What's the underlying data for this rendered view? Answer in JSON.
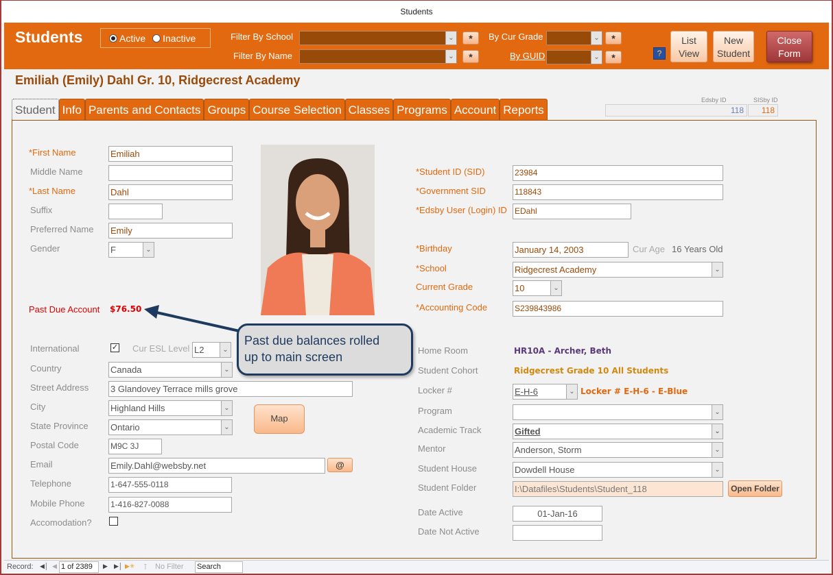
{
  "window": {
    "title": "Students"
  },
  "header": {
    "app_title": "Students",
    "status_filter": {
      "options": [
        "Active",
        "Inactive"
      ],
      "selected": "Active"
    },
    "filter_school_label": "Filter By School",
    "filter_name_label": "Filter By Name",
    "cur_grade_label": "By Cur Grade",
    "guid_label": "By GUID",
    "filter_school_value": "",
    "filter_name_value": "",
    "cur_grade_value": "",
    "guid_value": "",
    "clear_label": "*",
    "help_label": "?",
    "list_view_label": [
      "List",
      "View"
    ],
    "new_student_label": [
      "New",
      "Student"
    ],
    "close_form_label": [
      "Close",
      "Form"
    ]
  },
  "student_heading": "Emiliah (Emily)  Dahl  Gr. 10, Ridgecrest Academy",
  "tabs": [
    {
      "label": "Student",
      "active": true
    },
    {
      "label": "Info"
    },
    {
      "label": "Parents and Contacts"
    },
    {
      "label": "Groups"
    },
    {
      "label": "Course Selection"
    },
    {
      "label": "Classes"
    },
    {
      "label": "Programs"
    },
    {
      "label": "Account"
    },
    {
      "label": "Reports"
    }
  ],
  "ids": {
    "edsby_label": "Edsby ID",
    "edsby_value": "118",
    "sisby_label": "SISby ID",
    "sisby_value": "118"
  },
  "left": {
    "first_name": {
      "label": "*First Name",
      "value": "Emiliah"
    },
    "middle_name": {
      "label": "Middle Name",
      "value": ""
    },
    "last_name": {
      "label": "*Last Name",
      "value": "Dahl"
    },
    "suffix": {
      "label": "Suffix",
      "value": ""
    },
    "preferred_name": {
      "label": "Preferred Name",
      "value": "Emily"
    },
    "gender": {
      "label": "Gender",
      "value": "F"
    },
    "past_due": {
      "label": "Past Due Account",
      "value": "$76.50"
    },
    "international": {
      "label": "International",
      "checked": true
    },
    "esl_level": {
      "label": "Cur ESL Level",
      "value": "L2"
    },
    "country": {
      "label": "Country",
      "value": "Canada"
    },
    "street": {
      "label": "Street Address",
      "value": "3 Glandovey Terrace mills grove"
    },
    "city": {
      "label": "City",
      "value": "Highland Hills"
    },
    "state": {
      "label": "State Province",
      "value": "Ontario"
    },
    "postal": {
      "label": "Postal Code",
      "value": "M9C 3J"
    },
    "email": {
      "label": "Email",
      "value": "Emily.Dahl@websby.net",
      "button": "@"
    },
    "telephone": {
      "label": "Telephone",
      "value": "1-647-555-0118"
    },
    "mobile": {
      "label": "Mobile Phone",
      "value": "1-416-827-0088"
    },
    "accommodation": {
      "label": "Accomodation?",
      "checked": false
    },
    "map_button": "Map"
  },
  "right": {
    "student_id": {
      "label": "*Student ID (SID)",
      "value": "23984"
    },
    "gov_sid": {
      "label": "*Government SID",
      "value": "118843"
    },
    "edsby_login": {
      "label": "*Edsby User (Login) ID",
      "value": "EDahl"
    },
    "birthday": {
      "label": "*Birthday",
      "value": "January 14, 2003"
    },
    "cur_age": {
      "label": "Cur Age",
      "value": "16 Years Old"
    },
    "school": {
      "label": "*School",
      "value": "Ridgecrest Academy"
    },
    "grade": {
      "label": "Current Grade",
      "value": "10"
    },
    "accounting": {
      "label": "*Accounting Code",
      "value": "S239843986"
    },
    "home_room": {
      "label": "Home Room",
      "value": "HR10A - Archer, Beth"
    },
    "cohort": {
      "label": "Student Cohort",
      "value": "Ridgecrest Grade 10 All Students"
    },
    "locker": {
      "label": "Locker #",
      "value": "E-H-6",
      "description": "Locker # E-H-6 - E-Blue"
    },
    "program": {
      "label": "Program",
      "value": ""
    },
    "track": {
      "label": "Academic Track",
      "value": "Gifted"
    },
    "mentor": {
      "label": "Mentor",
      "value": "Anderson, Storm"
    },
    "house": {
      "label": "Student House",
      "value": "Dowdell House"
    },
    "folder": {
      "label": "Student Folder",
      "value": "I:\\Datafiles\\Students\\Student_118",
      "button": "Open Folder"
    },
    "date_active": {
      "label": "Date Active",
      "value": "01-Jan-16"
    },
    "date_not_active": {
      "label": "Date Not Active",
      "value": ""
    }
  },
  "callout": {
    "text": [
      "Past due balances rolled",
      "up to main screen"
    ]
  },
  "statusbar": {
    "record_label": "Record:",
    "record_value": "1 of 2389",
    "filter_label": "No Filter",
    "search_label": "Search"
  },
  "colors": {
    "header_bg": "#e2690f",
    "required_label": "#e2690f",
    "past_due": "#e00000",
    "home_room": "#5a3a7a",
    "cohort": "#d08a10",
    "locker_desc": "#e2690f",
    "callout_border": "#1e3a5f"
  }
}
